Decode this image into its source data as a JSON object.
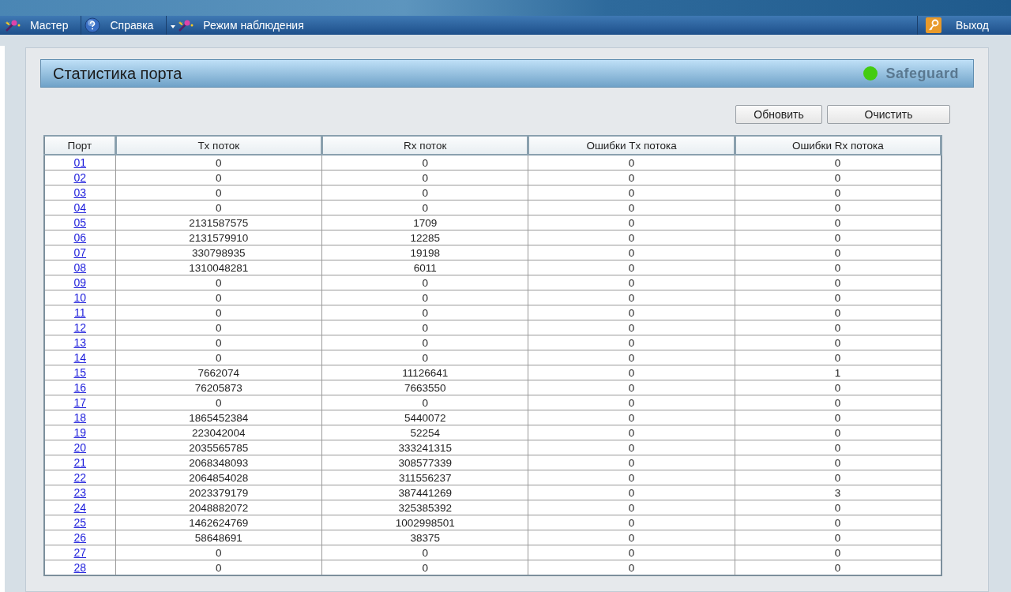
{
  "nav": {
    "items": [
      {
        "kind": "wand",
        "label": "Мастер"
      },
      {
        "kind": "help",
        "label": "Справка"
      },
      {
        "kind": "wand-drop",
        "label": "Режим наблюдения"
      }
    ],
    "logout": {
      "label": "Выход"
    }
  },
  "panel": {
    "title": "Статистика порта",
    "safeguard": {
      "label": "Safeguard",
      "color": "#44cc11"
    }
  },
  "buttons": [
    "Обновить",
    "Очистить"
  ],
  "table": {
    "columns": [
      "Порт",
      "Tx поток",
      "Rx поток",
      "Ошибки Tx потока",
      "Ошибки Rx потока"
    ],
    "rows": [
      {
        "cells": [
          "01",
          "0",
          "0",
          "0",
          "0"
        ]
      },
      {
        "cells": [
          "02",
          "0",
          "0",
          "0",
          "0"
        ]
      },
      {
        "cells": [
          "03",
          "0",
          "0",
          "0",
          "0"
        ]
      },
      {
        "cells": [
          "04",
          "0",
          "0",
          "0",
          "0"
        ]
      },
      {
        "cells": [
          "05",
          "2131587575",
          "1709",
          "0",
          "0"
        ]
      },
      {
        "cells": [
          "06",
          "2131579910",
          "12285",
          "0",
          "0"
        ]
      },
      {
        "cells": [
          "07",
          "330798935",
          "19198",
          "0",
          "0"
        ]
      },
      {
        "cells": [
          "08",
          "1310048281",
          "6011",
          "0",
          "0"
        ]
      },
      {
        "cells": [
          "09",
          "0",
          "0",
          "0",
          "0"
        ]
      },
      {
        "cells": [
          "10",
          "0",
          "0",
          "0",
          "0"
        ]
      },
      {
        "cells": [
          "11",
          "0",
          "0",
          "0",
          "0"
        ]
      },
      {
        "cells": [
          "12",
          "0",
          "0",
          "0",
          "0"
        ]
      },
      {
        "cells": [
          "13",
          "0",
          "0",
          "0",
          "0"
        ]
      },
      {
        "cells": [
          "14",
          "0",
          "0",
          "0",
          "0"
        ]
      },
      {
        "cells": [
          "15",
          "7662074",
          "11126641",
          "0",
          "1"
        ]
      },
      {
        "cells": [
          "16",
          "76205873",
          "7663550",
          "0",
          "0"
        ]
      },
      {
        "cells": [
          "17",
          "0",
          "0",
          "0",
          "0"
        ]
      },
      {
        "cells": [
          "18",
          "1865452384",
          "5440072",
          "0",
          "0"
        ]
      },
      {
        "cells": [
          "19",
          "223042004",
          "52254",
          "0",
          "0"
        ]
      },
      {
        "cells": [
          "20",
          "2035565785",
          "333241315",
          "0",
          "0"
        ]
      },
      {
        "cells": [
          "21",
          "2068348093",
          "308577339",
          "0",
          "0"
        ]
      },
      {
        "cells": [
          "22",
          "2064854028",
          "311556237",
          "0",
          "0"
        ]
      },
      {
        "cells": [
          "23",
          "2023379179",
          "387441269",
          "0",
          "3"
        ]
      },
      {
        "cells": [
          "24",
          "2048882072",
          "325385392",
          "0",
          "0"
        ]
      },
      {
        "cells": [
          "25",
          "1462624769",
          "1002998501",
          "0",
          "0"
        ]
      },
      {
        "cells": [
          "26",
          "58648691",
          "38375",
          "0",
          "0"
        ]
      },
      {
        "cells": [
          "27",
          "0",
          "0",
          "0",
          "0"
        ]
      },
      {
        "cells": [
          "28",
          "0",
          "0",
          "0",
          "0"
        ]
      }
    ]
  }
}
